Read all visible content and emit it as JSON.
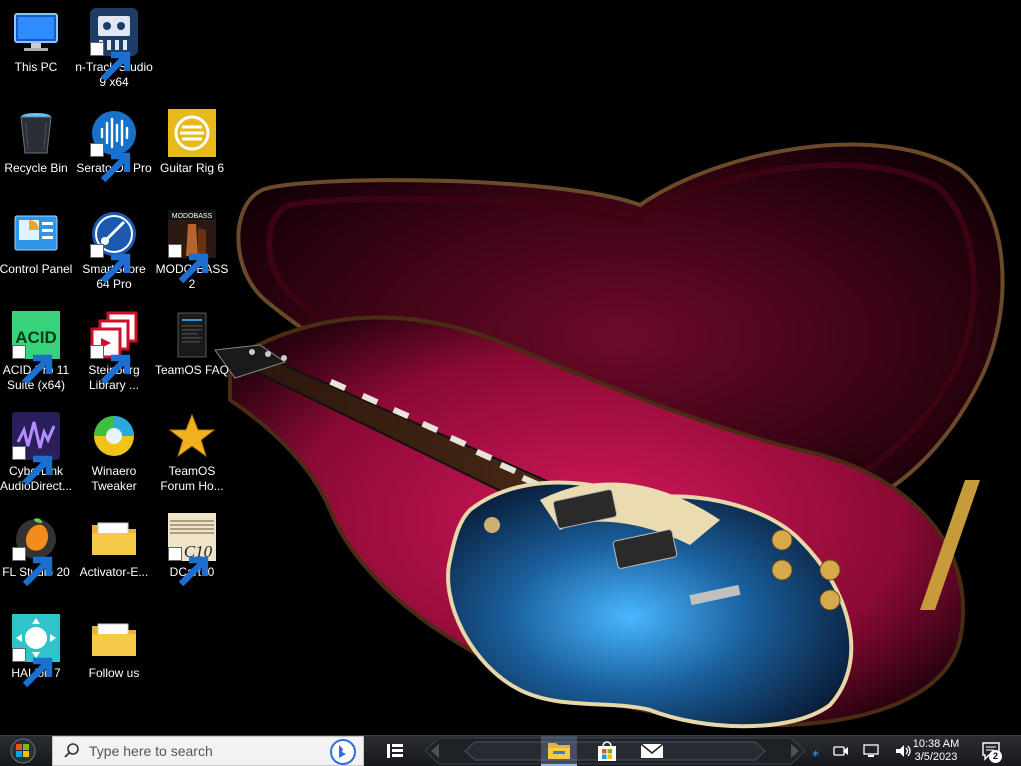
{
  "desktop": {
    "icons": [
      {
        "id": "this-pc",
        "label": "This PC"
      },
      {
        "id": "n-track",
        "label": "n-Track Studio 9 x64"
      },
      {
        "id": "recycle-bin",
        "label": "Recycle Bin"
      },
      {
        "id": "serato",
        "label": "Serato DJ Pro"
      },
      {
        "id": "guitar-rig",
        "label": "Guitar Rig 6"
      },
      {
        "id": "control-panel",
        "label": "Control Panel"
      },
      {
        "id": "smartscore",
        "label": "SmartScore 64 Pro"
      },
      {
        "id": "modo-bass",
        "label": "MODO BASS 2"
      },
      {
        "id": "acid-pro",
        "label": "ACID Pro 11 Suite (x64)"
      },
      {
        "id": "steinberg",
        "label": "Steinberg Library ..."
      },
      {
        "id": "teamos-faq",
        "label": "TeamOS FAQ"
      },
      {
        "id": "cyberlink",
        "label": "CyberLink AudioDirect..."
      },
      {
        "id": "winaero",
        "label": "Winaero Tweaker"
      },
      {
        "id": "teamos-forum",
        "label": "TeamOS Forum Ho..."
      },
      {
        "id": "fl-studio",
        "label": "FL Studio 20"
      },
      {
        "id": "activator",
        "label": "Activator-E..."
      },
      {
        "id": "dcart",
        "label": "DCart10"
      },
      {
        "id": "halion",
        "label": "HALion 7"
      },
      {
        "id": "follow-us",
        "label": "Follow us"
      }
    ],
    "modo_logo_text": "MODOBASS",
    "acid_logo_text": "ACID",
    "dcart_logo_text": "C10"
  },
  "taskbar": {
    "search_placeholder": "Type here to search",
    "clock_time": "10:38 AM",
    "clock_date": "3/5/2023",
    "notification_count": "2",
    "pinned": [
      "file-explorer",
      "microsoft-store",
      "mail"
    ]
  },
  "colors": {
    "taskbar_bg": "#1c1e22",
    "accent_blue": "#1e90ff",
    "case_lining": "#c8104a",
    "guitar_blue": "#1f6fa8"
  }
}
